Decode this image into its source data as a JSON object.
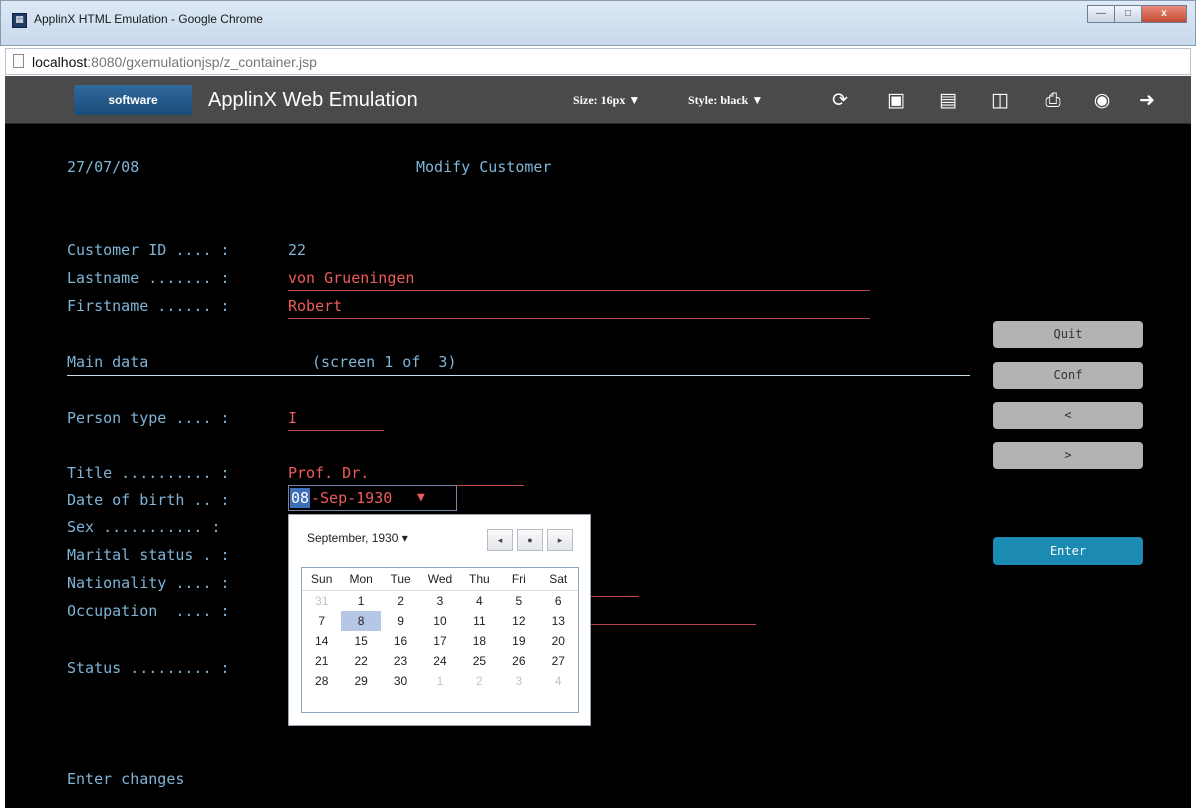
{
  "window": {
    "title": "ApplinX HTML Emulation - Google Chrome",
    "min_label": "—",
    "max_label": "□",
    "close_label": "x"
  },
  "address": {
    "host": "localhost",
    "path": ":8080/gxemulationjsp/z_container.jsp"
  },
  "header": {
    "logo_text": "software",
    "title": "ApplinX Web Emulation",
    "size_label": "Size:",
    "size_value": "16px",
    "style_label": "Style:",
    "style_value": "black",
    "icons": [
      "refresh-icon",
      "macro-icon",
      "copy-icon",
      "folder-icon",
      "print-icon",
      "camera-icon",
      "exit-icon"
    ]
  },
  "terminal": {
    "date": "27/07/08",
    "screen_title": "Modify Customer",
    "customer_id_label": "Customer ID .... : ",
    "customer_id_value": "22",
    "lastname_label": "Lastname ....... : ",
    "lastname_value": "von Grueningen",
    "firstname_label": "Firstname ...... : ",
    "firstname_value": "Robert",
    "section_label": "Main data",
    "section_screen": "(screen 1 of  3)",
    "person_type_label": "Person type .... : ",
    "person_type_value": "I",
    "title_label": "Title .......... : ",
    "title_value": "Prof. Dr.",
    "dob_label": "Date of birth .. : ",
    "dob_day": "08",
    "dob_rest": "-Sep-1930",
    "dob_arrow": "▼",
    "sex_label": "Sex ........... : ",
    "marital_label": "Marital status . : ",
    "nationality_label": "Nationality .... : ",
    "occupation_label": "Occupation  .... : ",
    "status_label": "Status ......... : ",
    "footer": "Enter changes"
  },
  "side_buttons": {
    "quit": "Quit",
    "conf": "Conf",
    "prev": "<",
    "next": ">",
    "enter": "Enter"
  },
  "calendar": {
    "month_label": "September, 1930 ▾",
    "nav_prev": "◂",
    "nav_today": "●",
    "nav_next": "▸",
    "weekdays": [
      "Sun",
      "Mon",
      "Tue",
      "Wed",
      "Thu",
      "Fri",
      "Sat"
    ],
    "weeks": [
      [
        "31",
        "1",
        "2",
        "3",
        "4",
        "5",
        "6"
      ],
      [
        "7",
        "8",
        "9",
        "10",
        "11",
        "12",
        "13"
      ],
      [
        "14",
        "15",
        "16",
        "17",
        "18",
        "19",
        "20"
      ],
      [
        "21",
        "22",
        "23",
        "24",
        "25",
        "26",
        "27"
      ],
      [
        "28",
        "29",
        "30",
        "1",
        "2",
        "3",
        "4"
      ]
    ]
  }
}
